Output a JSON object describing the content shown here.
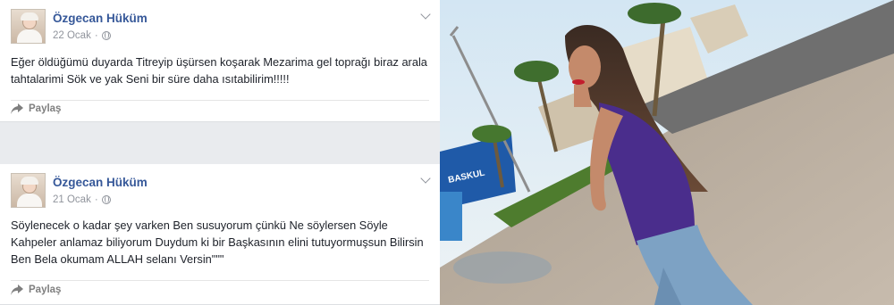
{
  "posts": [
    {
      "author": "Özgecan Hüküm",
      "date": "22 Ocak",
      "separator": "·",
      "text": "Eğer öldüğümü duyarda Titreyip üşürsen koşarak Mezarima gel toprağı biraz arala tahtalarimi Sök ve yak Seni bir süre daha ısıtabilirim!!!!!",
      "share_label": "Paylaş"
    },
    {
      "author": "Özgecan Hüküm",
      "date": "21 Ocak",
      "separator": "·",
      "text": "Söylenecek o kadar şey varken Ben susuyorum çünkü Ne söylersen Söyle Kahpeler anlamaz biliyorum Duydum ki bir Başkasının elini tutuyormuşsun Bilirsin Ben Bela okumam ALLAH selanı Versin\"\"\"",
      "share_label": "Paylaş"
    }
  ],
  "photo": {
    "sign_text": "BASKUL"
  },
  "colors": {
    "author": "#365899",
    "text": "#1d2129",
    "meta": "#90949c",
    "feed_bg": "#e9ebee"
  },
  "icons": [
    "globe-icon",
    "chevron-down-icon",
    "share-icon"
  ]
}
